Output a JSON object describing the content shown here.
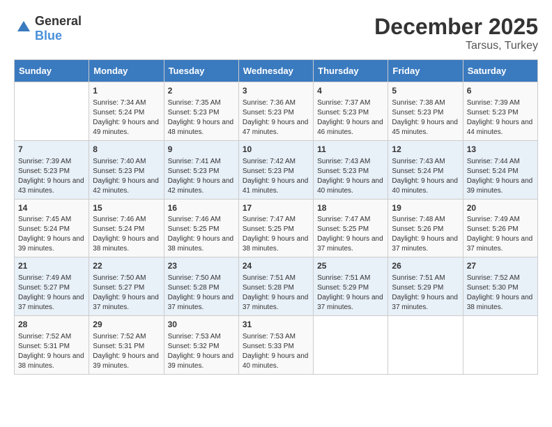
{
  "header": {
    "logo_general": "General",
    "logo_blue": "Blue",
    "title": "December 2025",
    "location": "Tarsus, Turkey"
  },
  "days_of_week": [
    "Sunday",
    "Monday",
    "Tuesday",
    "Wednesday",
    "Thursday",
    "Friday",
    "Saturday"
  ],
  "weeks": [
    [
      {
        "day": "",
        "sunrise": "",
        "sunset": "",
        "daylight": ""
      },
      {
        "day": "1",
        "sunrise": "Sunrise: 7:34 AM",
        "sunset": "Sunset: 5:24 PM",
        "daylight": "Daylight: 9 hours and 49 minutes."
      },
      {
        "day": "2",
        "sunrise": "Sunrise: 7:35 AM",
        "sunset": "Sunset: 5:23 PM",
        "daylight": "Daylight: 9 hours and 48 minutes."
      },
      {
        "day": "3",
        "sunrise": "Sunrise: 7:36 AM",
        "sunset": "Sunset: 5:23 PM",
        "daylight": "Daylight: 9 hours and 47 minutes."
      },
      {
        "day": "4",
        "sunrise": "Sunrise: 7:37 AM",
        "sunset": "Sunset: 5:23 PM",
        "daylight": "Daylight: 9 hours and 46 minutes."
      },
      {
        "day": "5",
        "sunrise": "Sunrise: 7:38 AM",
        "sunset": "Sunset: 5:23 PM",
        "daylight": "Daylight: 9 hours and 45 minutes."
      },
      {
        "day": "6",
        "sunrise": "Sunrise: 7:39 AM",
        "sunset": "Sunset: 5:23 PM",
        "daylight": "Daylight: 9 hours and 44 minutes."
      }
    ],
    [
      {
        "day": "7",
        "sunrise": "Sunrise: 7:39 AM",
        "sunset": "Sunset: 5:23 PM",
        "daylight": "Daylight: 9 hours and 43 minutes."
      },
      {
        "day": "8",
        "sunrise": "Sunrise: 7:40 AM",
        "sunset": "Sunset: 5:23 PM",
        "daylight": "Daylight: 9 hours and 42 minutes."
      },
      {
        "day": "9",
        "sunrise": "Sunrise: 7:41 AM",
        "sunset": "Sunset: 5:23 PM",
        "daylight": "Daylight: 9 hours and 42 minutes."
      },
      {
        "day": "10",
        "sunrise": "Sunrise: 7:42 AM",
        "sunset": "Sunset: 5:23 PM",
        "daylight": "Daylight: 9 hours and 41 minutes."
      },
      {
        "day": "11",
        "sunrise": "Sunrise: 7:43 AM",
        "sunset": "Sunset: 5:23 PM",
        "daylight": "Daylight: 9 hours and 40 minutes."
      },
      {
        "day": "12",
        "sunrise": "Sunrise: 7:43 AM",
        "sunset": "Sunset: 5:24 PM",
        "daylight": "Daylight: 9 hours and 40 minutes."
      },
      {
        "day": "13",
        "sunrise": "Sunrise: 7:44 AM",
        "sunset": "Sunset: 5:24 PM",
        "daylight": "Daylight: 9 hours and 39 minutes."
      }
    ],
    [
      {
        "day": "14",
        "sunrise": "Sunrise: 7:45 AM",
        "sunset": "Sunset: 5:24 PM",
        "daylight": "Daylight: 9 hours and 39 minutes."
      },
      {
        "day": "15",
        "sunrise": "Sunrise: 7:46 AM",
        "sunset": "Sunset: 5:24 PM",
        "daylight": "Daylight: 9 hours and 38 minutes."
      },
      {
        "day": "16",
        "sunrise": "Sunrise: 7:46 AM",
        "sunset": "Sunset: 5:25 PM",
        "daylight": "Daylight: 9 hours and 38 minutes."
      },
      {
        "day": "17",
        "sunrise": "Sunrise: 7:47 AM",
        "sunset": "Sunset: 5:25 PM",
        "daylight": "Daylight: 9 hours and 38 minutes."
      },
      {
        "day": "18",
        "sunrise": "Sunrise: 7:47 AM",
        "sunset": "Sunset: 5:25 PM",
        "daylight": "Daylight: 9 hours and 37 minutes."
      },
      {
        "day": "19",
        "sunrise": "Sunrise: 7:48 AM",
        "sunset": "Sunset: 5:26 PM",
        "daylight": "Daylight: 9 hours and 37 minutes."
      },
      {
        "day": "20",
        "sunrise": "Sunrise: 7:49 AM",
        "sunset": "Sunset: 5:26 PM",
        "daylight": "Daylight: 9 hours and 37 minutes."
      }
    ],
    [
      {
        "day": "21",
        "sunrise": "Sunrise: 7:49 AM",
        "sunset": "Sunset: 5:27 PM",
        "daylight": "Daylight: 9 hours and 37 minutes."
      },
      {
        "day": "22",
        "sunrise": "Sunrise: 7:50 AM",
        "sunset": "Sunset: 5:27 PM",
        "daylight": "Daylight: 9 hours and 37 minutes."
      },
      {
        "day": "23",
        "sunrise": "Sunrise: 7:50 AM",
        "sunset": "Sunset: 5:28 PM",
        "daylight": "Daylight: 9 hours and 37 minutes."
      },
      {
        "day": "24",
        "sunrise": "Sunrise: 7:51 AM",
        "sunset": "Sunset: 5:28 PM",
        "daylight": "Daylight: 9 hours and 37 minutes."
      },
      {
        "day": "25",
        "sunrise": "Sunrise: 7:51 AM",
        "sunset": "Sunset: 5:29 PM",
        "daylight": "Daylight: 9 hours and 37 minutes."
      },
      {
        "day": "26",
        "sunrise": "Sunrise: 7:51 AM",
        "sunset": "Sunset: 5:29 PM",
        "daylight": "Daylight: 9 hours and 37 minutes."
      },
      {
        "day": "27",
        "sunrise": "Sunrise: 7:52 AM",
        "sunset": "Sunset: 5:30 PM",
        "daylight": "Daylight: 9 hours and 38 minutes."
      }
    ],
    [
      {
        "day": "28",
        "sunrise": "Sunrise: 7:52 AM",
        "sunset": "Sunset: 5:31 PM",
        "daylight": "Daylight: 9 hours and 38 minutes."
      },
      {
        "day": "29",
        "sunrise": "Sunrise: 7:52 AM",
        "sunset": "Sunset: 5:31 PM",
        "daylight": "Daylight: 9 hours and 39 minutes."
      },
      {
        "day": "30",
        "sunrise": "Sunrise: 7:53 AM",
        "sunset": "Sunset: 5:32 PM",
        "daylight": "Daylight: 9 hours and 39 minutes."
      },
      {
        "day": "31",
        "sunrise": "Sunrise: 7:53 AM",
        "sunset": "Sunset: 5:33 PM",
        "daylight": "Daylight: 9 hours and 40 minutes."
      },
      {
        "day": "",
        "sunrise": "",
        "sunset": "",
        "daylight": ""
      },
      {
        "day": "",
        "sunrise": "",
        "sunset": "",
        "daylight": ""
      },
      {
        "day": "",
        "sunrise": "",
        "sunset": "",
        "daylight": ""
      }
    ]
  ]
}
